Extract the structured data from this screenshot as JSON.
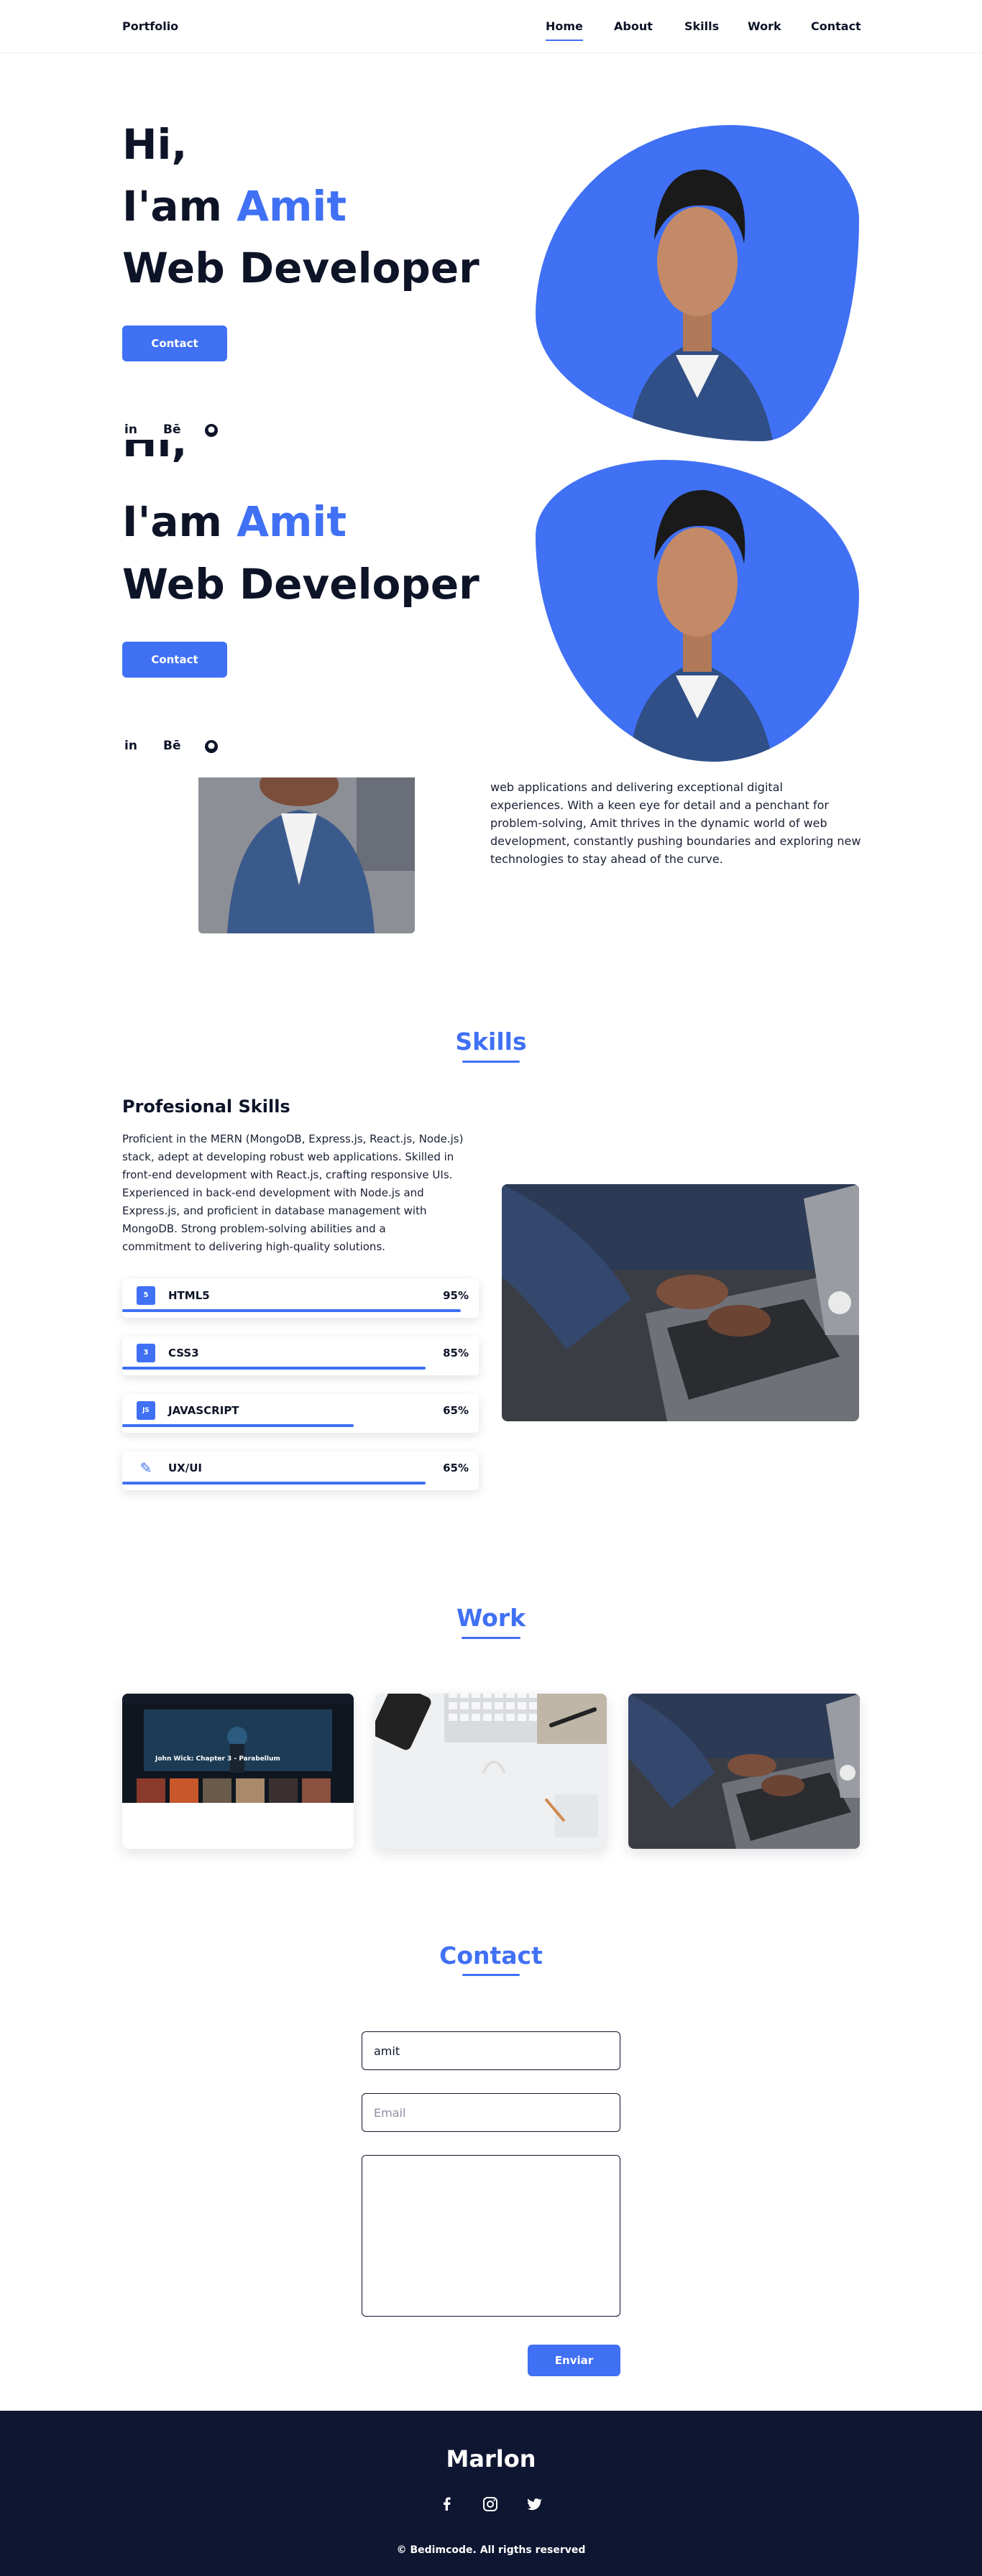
{
  "header": {
    "logo": "Portfolio",
    "nav": [
      "Home",
      "About",
      "Skills",
      "Work",
      "Contact"
    ],
    "active": "Home"
  },
  "hero": {
    "greeting": "Hi,",
    "iam_prefix": "I'am ",
    "name": "Amit",
    "role": "Web Developer",
    "contact_button": "Contact",
    "socials": [
      {
        "icon": "linkedin-icon",
        "glyph": "in"
      },
      {
        "icon": "behance-icon",
        "glyph": "Bē"
      },
      {
        "icon": "github-icon",
        "glyph": "⌾"
      }
    ]
  },
  "hero_repeat": {
    "greeting": "Hi,",
    "iam_prefix": "I'am ",
    "name": "Amit",
    "role": "Web Developer",
    "contact_button": "Contact"
  },
  "about": {
    "lines": [
      "web applications and delivering exceptional digital",
      "experiences. With a keen eye for detail and a penchant for",
      "problem-solving, Amit thrives in the dynamic world of web",
      "development, constantly pushing boundaries and exploring new",
      "technologies to stay ahead of the curve."
    ]
  },
  "skills": {
    "title": "Skills",
    "subtitle": "Profesional Skills",
    "description": [
      "Proficient in the MERN (MongoDB, Express.js, React.js, Node.js)",
      "stack, adept at developing robust web applications. Skilled in",
      "front-end development with React.js, crafting responsive UIs.",
      "Experienced in back-end development with Node.js and",
      "Express.js, and proficient in database management with",
      "MongoDB. Strong problem-solving abilities and a",
      "commitment to delivering high-quality solutions."
    ],
    "items": [
      {
        "name": "HTML5",
        "percent": "95%",
        "level": 0.95,
        "icon": "html5-icon",
        "glyph": "5"
      },
      {
        "name": "CSS3",
        "percent": "85%",
        "level": 0.85,
        "icon": "css3-icon",
        "glyph": "3"
      },
      {
        "name": "JAVASCRIPT",
        "percent": "65%",
        "level": 0.65,
        "icon": "javascript-icon",
        "glyph": "JS"
      },
      {
        "name": "UX/UI",
        "percent": "65%",
        "level": 0.85,
        "icon": "pen-icon",
        "glyph": "✎"
      }
    ]
  },
  "work": {
    "title": "Work",
    "card1_caption": "John Wick: Chapter 3 - Parabellum"
  },
  "contact": {
    "title": "Contact",
    "name_value": "amit",
    "email_placeholder": "Email",
    "message_value": "",
    "submit": "Enviar"
  },
  "footer": {
    "title": "Marlon",
    "socials": [
      "facebook-icon",
      "instagram-icon",
      "twitter-icon"
    ],
    "copyright": "© Bedimcode. All rigths reserved"
  },
  "colors": {
    "accent": "#4070f4",
    "dark": "#0e1428",
    "footer": "#0e1631"
  }
}
